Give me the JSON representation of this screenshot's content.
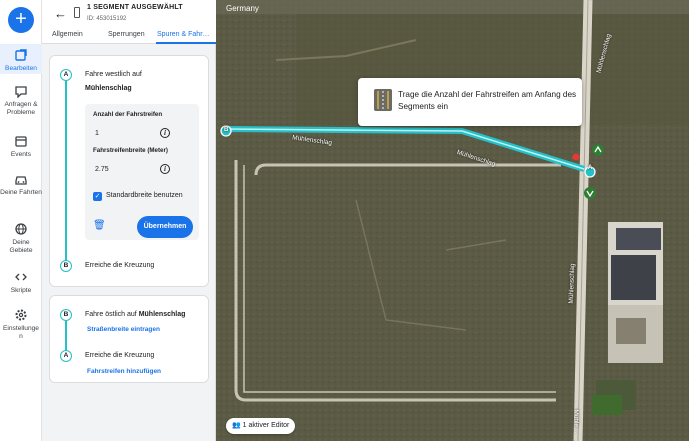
{
  "rail": {
    "items": [
      {
        "label": "Bearbeiten",
        "icon": "edit-segment-icon"
      },
      {
        "label": "Anfragen & Probleme",
        "icon": "requests-icon"
      },
      {
        "label": "Events",
        "icon": "calendar-icon"
      },
      {
        "label": "Deine Fahrten",
        "icon": "car-icon"
      },
      {
        "label": "Deine Gebiete",
        "icon": "globe-icon"
      },
      {
        "label": "Skripte",
        "icon": "code-icon"
      },
      {
        "label": "Einstellungen",
        "icon": "gear-icon"
      }
    ]
  },
  "header": {
    "title": "1 SEGMENT AUSGEWÄHLT",
    "id": "ID: 453015192"
  },
  "tabs": [
    "Allgemein",
    "Sperrungen",
    "Spuren & Fahr…"
  ],
  "direction_a": {
    "step_start": "A",
    "line1": "Fahre westlich auf",
    "street": "Mühlenschlag",
    "lanes_label": "Anzahl der Fahrstreifen",
    "lanes_value": "1",
    "width_label": "Fahrstreifenbreite (Meter)",
    "width_value": "2.75",
    "checkbox_label": "Standardbreite benutzen",
    "apply_label": "Übernehmen",
    "step_end": "B",
    "end_text": "Erreiche die Kreuzung"
  },
  "direction_b": {
    "step_start": "B",
    "line1": "Fahre östlich auf",
    "street": "Mühlenschlag",
    "link1": "Straßenbreite eintragen",
    "step_end": "A",
    "end_text": "Erreiche die Kreuzung",
    "link2": "Fahrstreifen hinzufügen"
  },
  "map": {
    "country": "Germany",
    "tooltip": "Trage die Anzahl der Fahrstreifen am Anfang des Segments ein",
    "editor_pill": "1 aktiver Editor",
    "street_labels": [
      "Mühlenschlag",
      "Mühlenschlag",
      "Mühlenschlag",
      "Mühlenschlag",
      "Mühle…"
    ],
    "node_a": "A",
    "node_b": "B"
  },
  "colors": {
    "accent": "#1a73e8",
    "segment": "#26c0c7"
  }
}
